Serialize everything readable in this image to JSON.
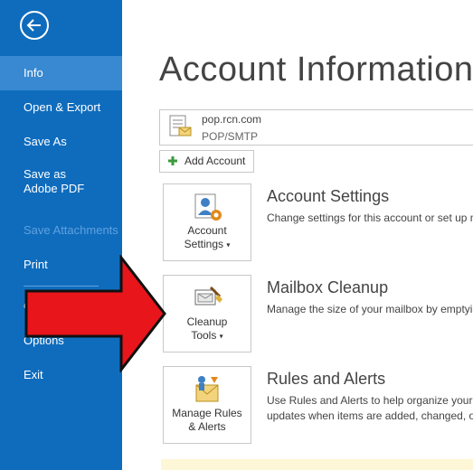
{
  "sidebar": {
    "items": [
      {
        "label": "Info"
      },
      {
        "label": "Open & Export"
      },
      {
        "label": "Save As"
      },
      {
        "label": "Save as Adobe PDF"
      },
      {
        "label": "Save Attachments"
      },
      {
        "label": "Print"
      },
      {
        "label": "Office Account"
      },
      {
        "label": "Options"
      },
      {
        "label": "Exit"
      }
    ]
  },
  "main": {
    "title": "Account Information",
    "account": {
      "name": "pop.rcn.com",
      "type": "POP/SMTP"
    },
    "add_account_label": "Add Account",
    "sections": [
      {
        "tile_line1": "Account",
        "tile_line2": "Settings",
        "title": "Account Settings",
        "desc_line1": "Change settings for this account or set up m",
        "desc_line2": ""
      },
      {
        "tile_line1": "Cleanup",
        "tile_line2": "Tools",
        "title": "Mailbox Cleanup",
        "desc_line1": "Manage the size of your mailbox by emptyi",
        "desc_line2": ""
      },
      {
        "tile_line1": "Manage Rules",
        "tile_line2": "& Alerts",
        "title": "Rules and Alerts",
        "desc_line1": "Use Rules and Alerts to help organize your i",
        "desc_line2": "updates when items are added, changed, or"
      }
    ]
  },
  "colors": {
    "sidebar": "#0f6cbd",
    "active": "#3889d1",
    "arrow": "#e8151b"
  }
}
